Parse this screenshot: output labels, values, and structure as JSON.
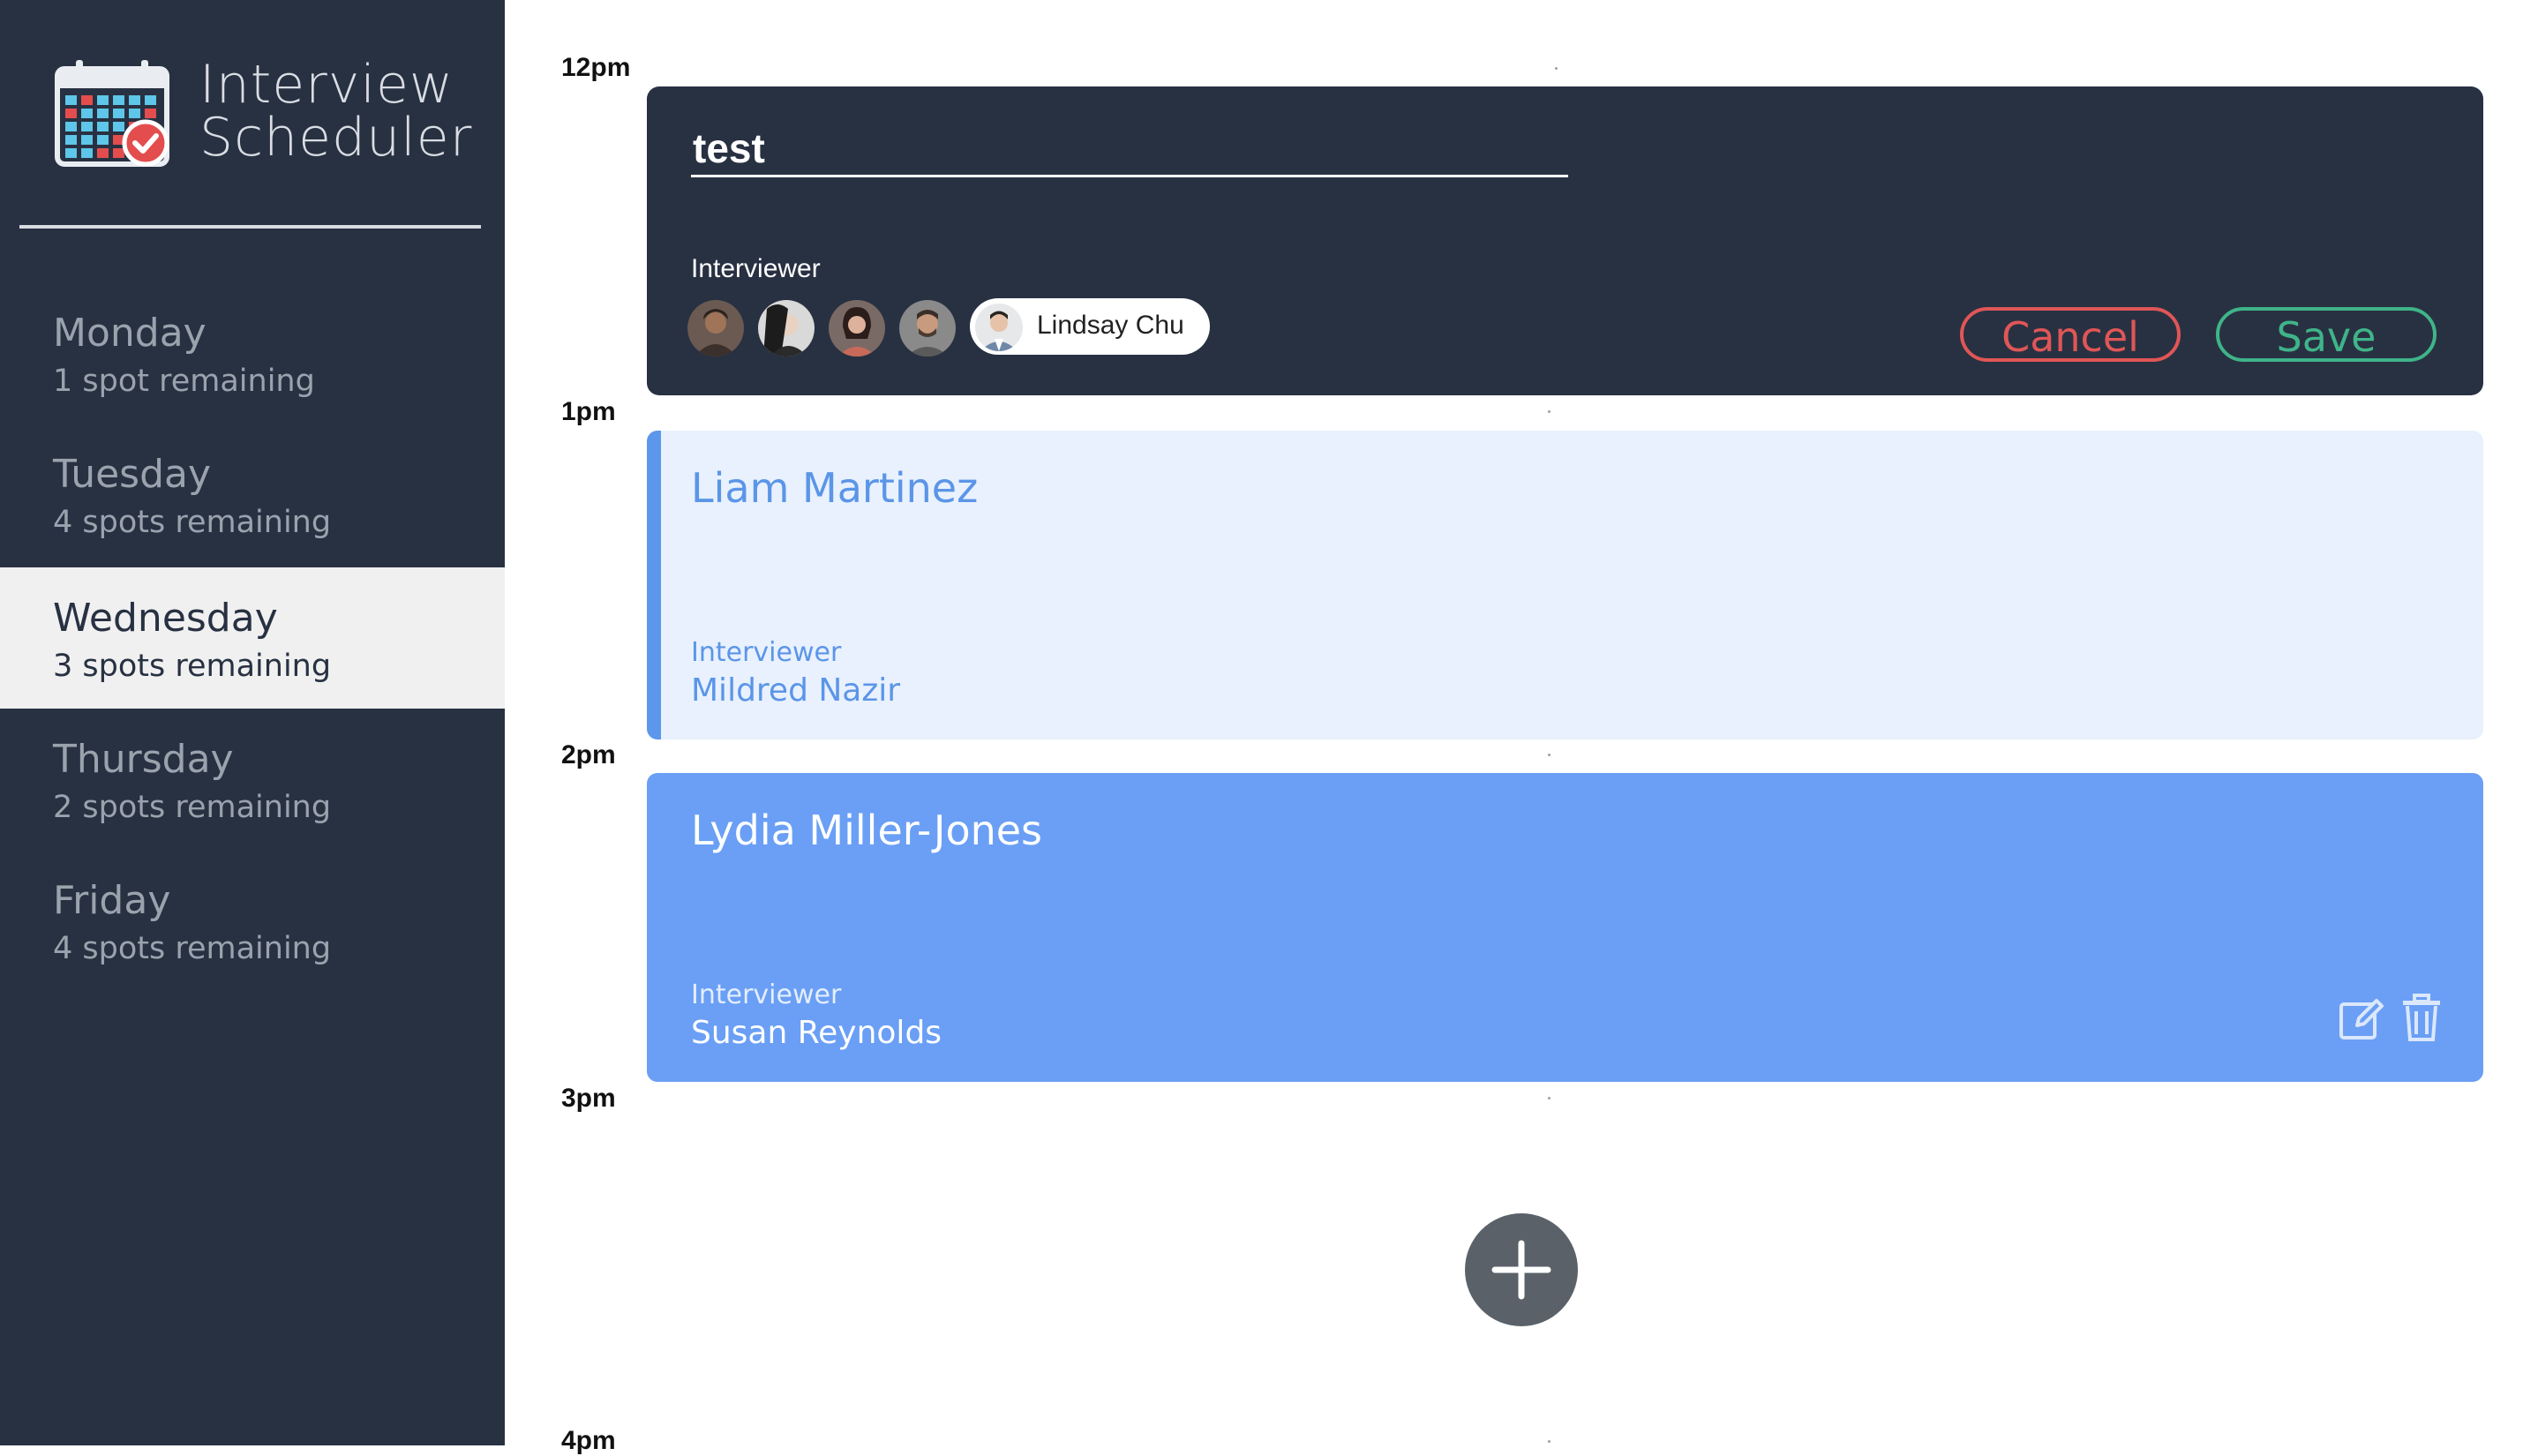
{
  "app": {
    "title_line1": "Interview",
    "title_line2": "Scheduler"
  },
  "days": [
    {
      "name": "Monday",
      "spots": "1 spot remaining",
      "selected": false
    },
    {
      "name": "Tuesday",
      "spots": "4 spots remaining",
      "selected": false
    },
    {
      "name": "Wednesday",
      "spots": "3 spots remaining",
      "selected": true
    },
    {
      "name": "Thursday",
      "spots": "2 spots remaining",
      "selected": false
    },
    {
      "name": "Friday",
      "spots": "4 spots remaining",
      "selected": false
    }
  ],
  "times": [
    "12pm",
    "1pm",
    "2pm",
    "3pm",
    "4pm"
  ],
  "form": {
    "student_value": "test",
    "interviewer_label": "Interviewer",
    "selected_interviewer": "Lindsay Chu",
    "cancel_label": "Cancel",
    "save_label": "Save"
  },
  "appointments": [
    {
      "student": "Liam Martinez",
      "interviewer_label": "Interviewer",
      "interviewer": "Mildred Nazir"
    },
    {
      "student": "Lydia Miller-Jones",
      "interviewer_label": "Interviewer",
      "interviewer": "Susan Reynolds"
    }
  ],
  "colors": {
    "sidebar": "#283142",
    "cancel": "#e05656",
    "save": "#3fb489",
    "appointment_light": "#e8f1fd",
    "appointment_dark": "#6a9ff5"
  },
  "icons": {
    "logo": "calendar-check-icon",
    "edit": "edit-icon",
    "delete": "trash-icon",
    "add": "plus-icon"
  }
}
